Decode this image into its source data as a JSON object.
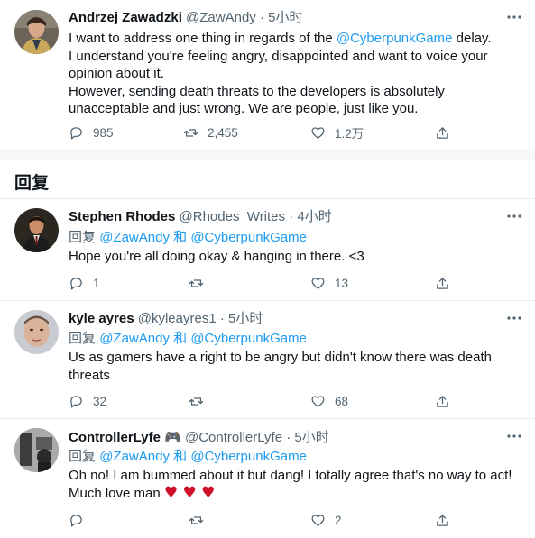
{
  "main_tweet": {
    "name": "Andrzej Zawadzki",
    "handle": "@ZawAndy",
    "time": "· 5小时",
    "text_before_mention": "I want to address one thing in regards of the ",
    "mention": "@CyberpunkGame",
    "text_after_mention": " delay.",
    "line2": "I understand you're feeling angry, disappointed and want to voice your opinion about it.",
    "line3": "However, sending death threats to the developers is absolutely unacceptable and just wrong. We are people, just like you.",
    "replies": "985",
    "retweets": "2,455",
    "likes": "1.2万"
  },
  "section_title": "回复",
  "replies": [
    {
      "name": "Stephen Rhodes",
      "handle": "@Rhodes_Writes",
      "time": "· 4小时",
      "reply_prefix": "回复",
      "reply_to_1": "@ZawAndy",
      "reply_and": "和",
      "reply_to_2": "@CyberpunkGame",
      "text": "Hope you're all doing okay & hanging in there. <3",
      "replies": "1",
      "retweets": "",
      "likes": "13"
    },
    {
      "name": "kyle ayres",
      "handle": "@kyleayres1",
      "time": "· 5小时",
      "reply_prefix": "回复",
      "reply_to_1": "@ZawAndy",
      "reply_and": "和",
      "reply_to_2": "@CyberpunkGame",
      "text": "Us as gamers have a right to be angry but didn't know there was death threats",
      "replies": "32",
      "retweets": "",
      "likes": "68"
    },
    {
      "name": "ControllerLyfe",
      "name_emoji": "🎮",
      "handle": "@ControllerLyfe",
      "time": "· 5小时",
      "reply_prefix": "回复",
      "reply_to_1": "@ZawAndy",
      "reply_and": "和",
      "reply_to_2": "@CyberpunkGame",
      "text": "Oh no! I am bummed about it but dang! I totally agree that's no way to act! Much love man",
      "hearts": "♥ ♥ ♥",
      "replies": "",
      "retweets": "",
      "likes": "2"
    }
  ],
  "colors": {
    "accent": "#1d9bf0",
    "secondary_text": "#536471",
    "heart_emoji": "#d0102a"
  }
}
